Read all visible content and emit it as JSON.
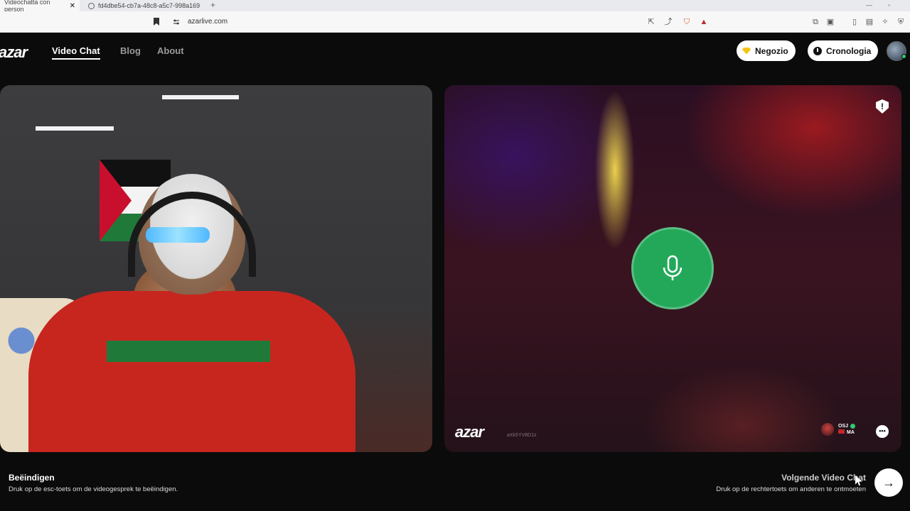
{
  "browser": {
    "tabs": [
      {
        "label": "Videochatta con person",
        "active": true
      },
      {
        "label": "fd4dbe54-cb7a-48c8-a5c7-998a169",
        "active": false
      }
    ],
    "url": "azarlive.com"
  },
  "header": {
    "logo": "azar",
    "nav": [
      "Video Chat",
      "Blog",
      "About"
    ],
    "shop_label": "Negozio",
    "history_label": "Cronologia"
  },
  "remote": {
    "logo": "azar",
    "user_id": "aXk5YV8D1z",
    "badge_name": "OSJ",
    "badge_country": "MA"
  },
  "footer": {
    "end_title": "Beëindigen",
    "end_hint": "Druk op de esc-toets om de videogesprek te beëindigen.",
    "next_title": "Volgende Video Chat",
    "next_hint": "Druk op de rechtertoets om anderen te ontmoeten"
  },
  "colors": {
    "mic_green": "#23a85a",
    "shop_gem": "#f5c518",
    "background": "#0b0b0b"
  },
  "icons": {
    "mic": "microphone-icon",
    "next": "arrow-right-icon",
    "report": "shield-alert-icon",
    "chat": "chat-bubble-icon"
  }
}
